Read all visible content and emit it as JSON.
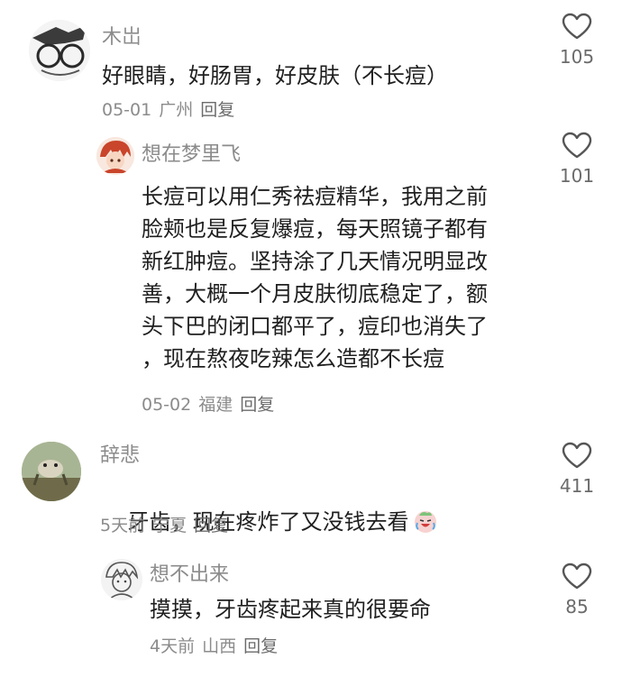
{
  "comments": [
    {
      "username": "木岀",
      "text": "好眼睛，好肠胃，好皮肤（不长痘）",
      "date": "05-01",
      "location": "广州",
      "reply_label": "回复",
      "likes": "105",
      "avatar_icon": "glasses-sketch-avatar"
    },
    {
      "username": "想在梦里飞",
      "text": "长痘可以用仁秀祛痘精华，我用之前\n脸颊也是反复爆痘，每天照镜子都有\n新红肿痘。坚持涂了几天情况明显改\n善，大概一个月皮肤彻底稳定了，额\n头下巴的闭口都平了，痘印也消失了\n，现在熬夜吃辣怎么造都不长痘",
      "date": "05-02",
      "location": "福建",
      "reply_label": "回复",
      "likes": "101",
      "avatar_icon": "red-hair-anime-avatar"
    },
    {
      "username": "辞悲",
      "text": "牙齿，现在疼炸了又没钱去看",
      "emoji": "crying-laughing-emoji",
      "date": "5天前",
      "location": "宁夏",
      "reply_label": "回复",
      "likes": "411",
      "avatar_icon": "frog-photo-avatar"
    },
    {
      "username": "想不出来",
      "text": "摸摸，牙齿疼起来真的很要命",
      "date": "4天前",
      "location": "山西",
      "reply_label": "回复",
      "likes": "85",
      "avatar_icon": "sketch-character-avatar"
    }
  ],
  "colors": {
    "text": "#1f1f1f",
    "muted": "#8b8b8b",
    "heart_stroke": "#555555"
  }
}
